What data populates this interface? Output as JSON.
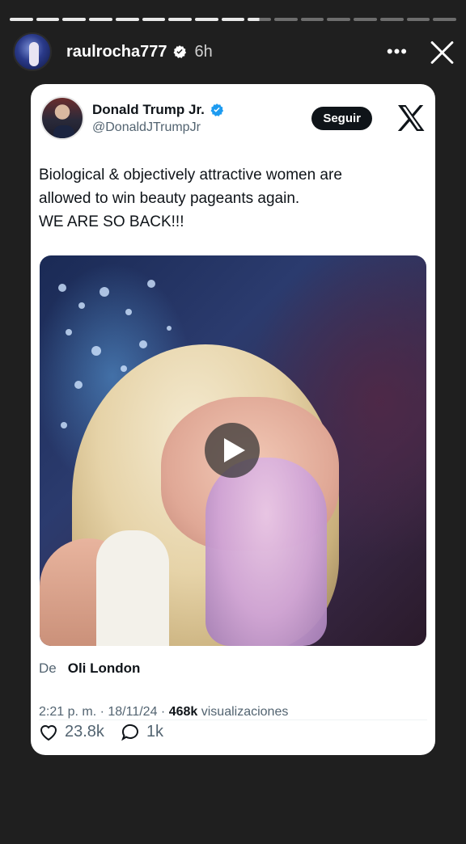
{
  "story": {
    "progress_segments": 17,
    "current_segment": 10,
    "username": "raulrocha777",
    "time": "6h",
    "more_icon": "more-horizontal-icon",
    "close_icon": "close-icon"
  },
  "tweet": {
    "display_name": "Donald Trump Jr.",
    "handle": "@DonaldJTrumpJr",
    "follow_label": "Seguir",
    "text_lines": [
      "Biological & objectively attractive women are",
      "allowed to win beauty pageants again.",
      "WE ARE SO BACK!!!"
    ],
    "media_type": "video",
    "quote_prefix": "De",
    "quote_author": "Oli London",
    "time": "2:21 p. m.",
    "date": "18/11/24",
    "views": "468k",
    "views_label": "visualizaciones",
    "likes": "23.8k",
    "replies": "1k"
  },
  "colors": {
    "background": "#1f1f1f",
    "card": "#ffffff",
    "verified": "#1d9bf0",
    "text_primary": "#0f1419",
    "text_secondary": "#536471"
  }
}
